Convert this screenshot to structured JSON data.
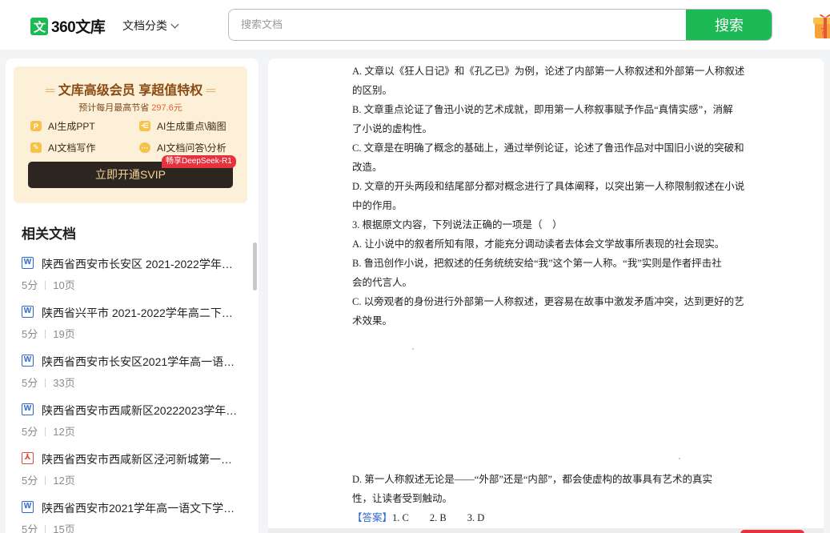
{
  "header": {
    "logo_mark": "文",
    "logo_text": "360文库",
    "category_label": "文档分类",
    "search_placeholder": "搜索文档",
    "search_button": "搜索",
    "brand_color": "#1db954"
  },
  "sidebar": {
    "vip": {
      "title": "文库高级会员 享超值特权",
      "subtitle_prefix": "预计每月最高节省",
      "subtitle_amount": "297.6元",
      "features": [
        {
          "icon": "ppt-icon",
          "label": "AI生成PPT"
        },
        {
          "icon": "mindmap-icon",
          "label": "AI生成重点\\脑图"
        },
        {
          "icon": "writing-icon",
          "label": "AI文档写作"
        },
        {
          "icon": "qa-icon",
          "label": "AI文档问答\\分析"
        }
      ],
      "badge": "畅享DeepSeek-R1",
      "button": "立即开通SVIP"
    },
    "related_title": "相关文档",
    "documents": [
      {
        "type": "word",
        "title": "陕西省西安市长安区 2021-2022学年高二下学期期末语文试题",
        "score": "5分",
        "pages": "10页"
      },
      {
        "type": "word",
        "title": "陕西省兴平市 2021-2022学年高二下学期期末语文试题",
        "score": "5分",
        "pages": "19页"
      },
      {
        "type": "word",
        "title": "陕西省西安市长安区2021学年高一语文下学期期末试题",
        "score": "5分",
        "pages": "33页"
      },
      {
        "type": "word",
        "title": "陕西省西安市西咸新区20222023学年高一语文试题",
        "score": "5分",
        "pages": "12页"
      },
      {
        "type": "pdf",
        "title": "陕西省西安市西咸新区泾河新城第一中学语文试题",
        "score": "5分",
        "pages": "12页"
      },
      {
        "type": "word",
        "title": "陕西省西安市2021学年高一语文下学期期末试题",
        "score": "5分",
        "pages": "15页"
      }
    ]
  },
  "document": {
    "lines": [
      "A. 文章以《狂人日记》和《孔乙已》为例，论述了内部第一人称叙述和外部第一人称叙述",
      "的区别。",
      "B. 文章重点论证了鲁迅小说的艺术成就，即用第一人称叙事赋予作品“真情实感”，消解",
      "了小说的虚构性。",
      "C. 文章是在明确了概念的基础上，通过举例论证，论述了鲁迅作品对中国旧小说的突破和",
      "改造。",
      "D. 文章的开头两段和结尾部分都对概念进行了具体阐释，以突出第一人称限制叙述在小说",
      "中的作用。",
      "3. 根据原文内容，下列说法正确的一项是（　）",
      "A. 让小说中的叙者所知有限，才能充分调动读者去体会文学故事所表现的社会现实。",
      "B. 鲁迅创作小说，把叙述的任务统统安给“我”这个第一人称。“我”实则是作者抨击社",
      "会的代言人。",
      "C. 以旁观者的身份进行外部第一人称叙述，更容易在故事中激发矛盾冲突，达到更好的艺",
      "术效果。"
    ],
    "lower_lines": [
      "D. 第一人称叙述无论是——“外部”还是“内部”，都会使虚构的故事具有艺术的真实",
      "性，让读者受到触动。"
    ],
    "answer_label": "【答案】",
    "answers": [
      "1. C",
      "2. B",
      "3. D"
    ]
  }
}
